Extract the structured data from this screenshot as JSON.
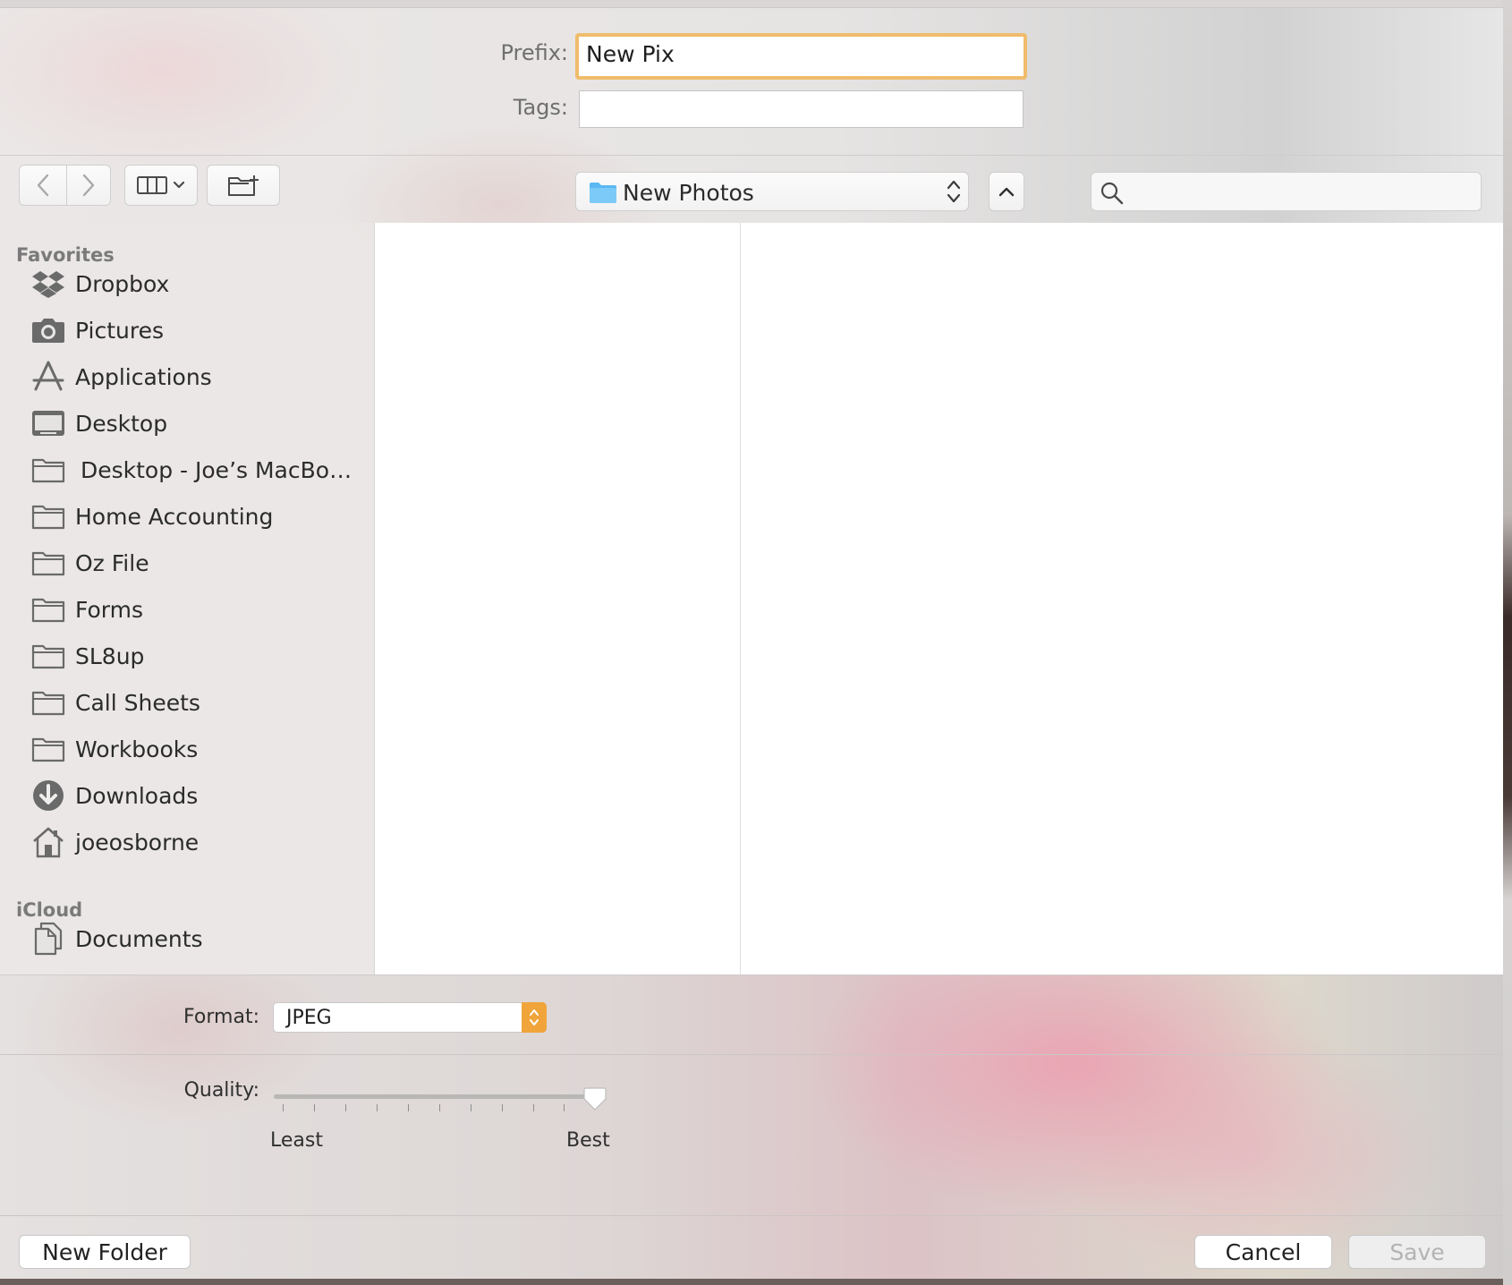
{
  "header": {
    "prefix_label": "Prefix:",
    "prefix_value": "New Pix",
    "tags_label": "Tags:",
    "tags_value": ""
  },
  "toolbar": {
    "path_popup_label": "New Photos",
    "search_placeholder": ""
  },
  "sidebar": {
    "favorites_title": "Favorites",
    "favorites": [
      {
        "label": "Dropbox",
        "icon": "dropbox-icon"
      },
      {
        "label": "Pictures",
        "icon": "camera-icon"
      },
      {
        "label": "Applications",
        "icon": "applications-icon"
      },
      {
        "label": "Desktop",
        "icon": "desktop-icon"
      },
      {
        "label": "Desktop - Joe’s MacBo…",
        "icon": "folder-icon"
      },
      {
        "label": "Home Accounting",
        "icon": "folder-icon"
      },
      {
        "label": "Oz File",
        "icon": "folder-icon"
      },
      {
        "label": "Forms",
        "icon": "folder-icon"
      },
      {
        "label": "SL8up",
        "icon": "folder-icon"
      },
      {
        "label": "Call Sheets",
        "icon": "folder-icon"
      },
      {
        "label": "Workbooks",
        "icon": "folder-icon"
      },
      {
        "label": "Downloads",
        "icon": "downloads-icon"
      },
      {
        "label": "joeosborne",
        "icon": "home-icon"
      }
    ],
    "icloud_title": "iCloud",
    "icloud": [
      {
        "label": "Documents",
        "icon": "documents-icon"
      }
    ]
  },
  "options": {
    "format_label": "Format:",
    "format_value": "JPEG",
    "quality_label": "Quality:",
    "quality_min_label": "Least",
    "quality_max_label": "Best",
    "quality_level": 1.0
  },
  "footer": {
    "new_folder_label": "New Folder",
    "cancel_label": "Cancel",
    "save_label": "Save"
  },
  "colors": {
    "focus_ring": "#f0bc6c",
    "accent_orange": "#f0a43a",
    "folder_blue": "#5bb8f2"
  }
}
